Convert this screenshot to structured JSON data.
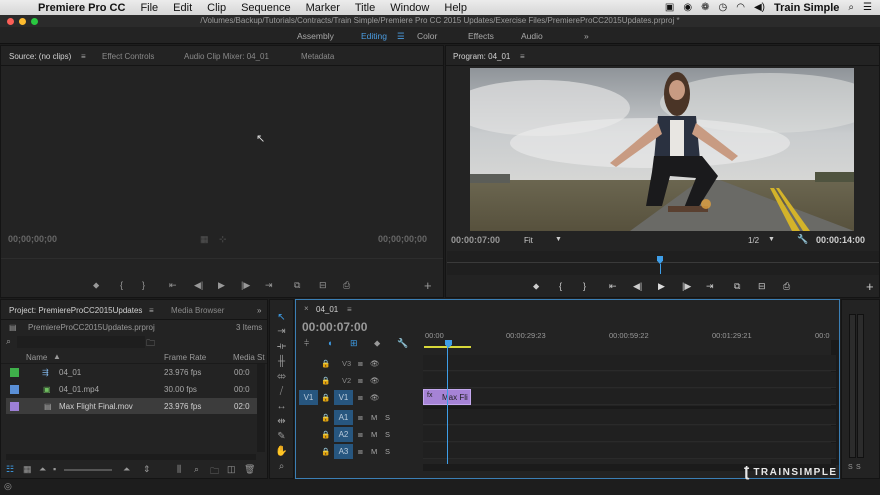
{
  "menubar": {
    "apple": "",
    "app_name": "Premiere Pro CC",
    "items": [
      "File",
      "Edit",
      "Clip",
      "Sequence",
      "Marker",
      "Title",
      "Window",
      "Help"
    ],
    "brand": "Train Simple"
  },
  "titlebar": {
    "path": "/Volumes/Backup/Tutorials/Contracts/Train Simple/Premiere Pro CC 2015 Updates/Exercise Files/PremiereProCC2015Updates.prproj *"
  },
  "workspaces": {
    "items": [
      "Assembly",
      "Editing",
      "Color",
      "Effects",
      "Audio"
    ],
    "active": "Editing",
    "more": "»"
  },
  "source_panel": {
    "tabs": [
      "Source: (no clips)",
      "Effect Controls",
      "Audio Clip Mixer: 04_01",
      "Metadata"
    ],
    "tc_left": "00;00;00;00",
    "tc_right": "00;00;00;00"
  },
  "program_panel": {
    "tab": "Program: 04_01",
    "tc_current": "00:00:07:00",
    "zoom": "Fit",
    "resolution": "1/2",
    "tc_duration": "00:00:14:00"
  },
  "project_panel": {
    "tabs": [
      "Project: PremiereProCC2015Updates",
      "Media Browser"
    ],
    "project_file": "PremiereProCC2015Updates.prproj",
    "item_count": "3 Items",
    "columns": [
      "Name",
      "Frame Rate",
      "Media St"
    ],
    "rows": [
      {
        "name": "04_01",
        "fps": "23.976 fps",
        "media": "00:0",
        "color": "#3fb04a"
      },
      {
        "name": "04_01.mp4",
        "fps": "30.00 fps",
        "media": "00:0",
        "color": "#5a8fd6"
      },
      {
        "name": "Max Flight Final.mov",
        "fps": "23.976 fps",
        "media": "02:0",
        "color": "#9d7fd6"
      }
    ]
  },
  "timeline": {
    "tab": "04_01",
    "playhead_tc": "00:00:07:00",
    "ruler": [
      "00:00",
      "00:00:29:23",
      "00:00:59:22",
      "00:01:29:21",
      "00:0"
    ],
    "video_tracks": [
      "V3",
      "V2",
      "V1"
    ],
    "audio_tracks": [
      "A1",
      "A2",
      "A3"
    ],
    "source_patch": "V1",
    "clip_label": "Max Fli",
    "m_label": "M",
    "s_label": "S"
  },
  "audio_meter": {
    "labels": [
      "S",
      "S"
    ]
  },
  "watermark": "TRAINSIMPLE",
  "colors": {
    "accent": "#3e9ee8",
    "clip": "#a683d6",
    "work_area": "#d8d83a"
  }
}
